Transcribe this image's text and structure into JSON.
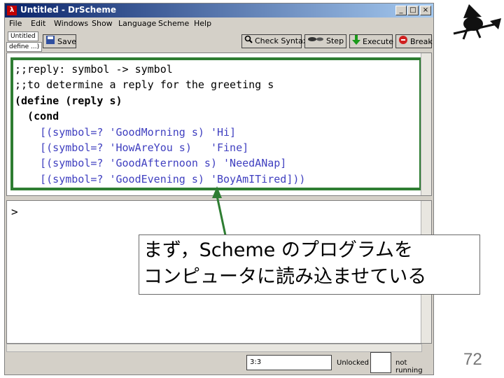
{
  "window": {
    "title": "Untitled - DrScheme",
    "app_icon_glyph": "λ"
  },
  "title_buttons": {
    "minimize": "_",
    "maximize": "□",
    "close": "×"
  },
  "menu": [
    "File",
    "Edit",
    "Windows",
    "Show",
    "Language",
    "Scheme",
    "Help"
  ],
  "toolbar": {
    "file_tag": "Untitled",
    "define_tag": "define ...)",
    "save": "Save",
    "check_syntax": "Check Syntax",
    "step": "Step",
    "execute": "Execute",
    "break": "Break"
  },
  "code_lines": [
    ";;reply: symbol -> symbol",
    ";;to determine a reply for the greeting s",
    "(define (reply s)",
    "  (cond",
    "    [(symbol=? 'GoodMorning s) 'Hi]",
    "    [(symbol=? 'HowAreYou s)   'Fine]",
    "    [(symbol=? 'GoodAfternoon s) 'NeedANap]",
    "    [(symbol=? 'GoodEvening s) 'BoyAmITired]))"
  ],
  "interactions": {
    "prompt": ">"
  },
  "status": {
    "position": "3:3",
    "lock_state": "Unlocked",
    "run_state": "not running"
  },
  "callout": {
    "line1": "まず，Scheme のプログラムを",
    "line2": "コンピュータに読み込ませている"
  },
  "page_number": "72",
  "colors": {
    "highlight_border": "#2e7d32",
    "arrow": "#2e7d32",
    "title_bar": "#0a246a"
  }
}
